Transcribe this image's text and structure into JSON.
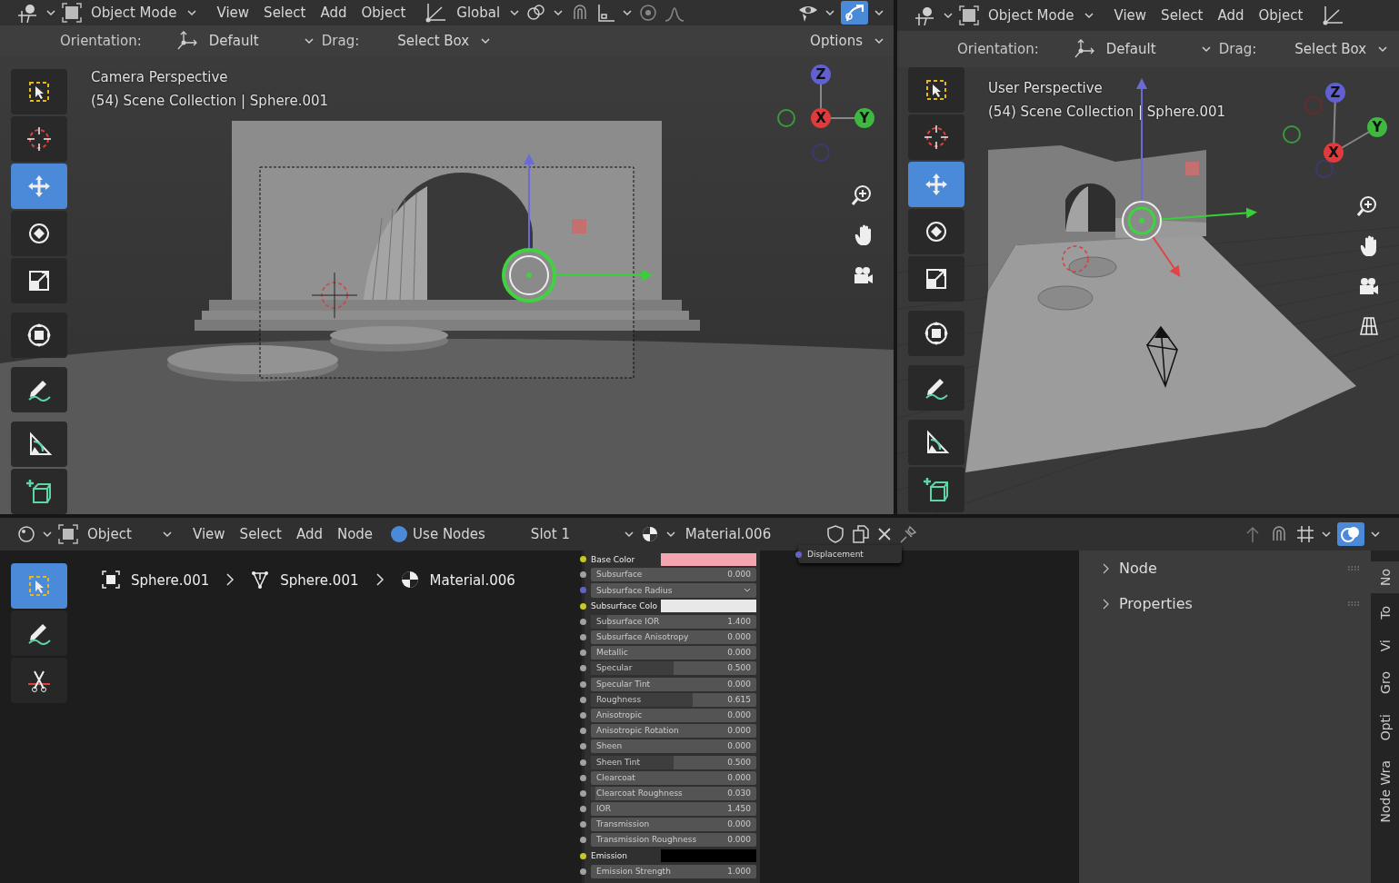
{
  "viewports": [
    {
      "kind": "camera",
      "header": {
        "mode": "Object Mode",
        "menus": [
          "View",
          "Select",
          "Add",
          "Object"
        ],
        "orientation": "Global",
        "gizmo_on": true
      },
      "tool_settings": {
        "orientation_label": "Orientation:",
        "orientation": "Default",
        "drag_label": "Drag:",
        "drag": "Select Box",
        "options": "Options"
      },
      "view_name": "Camera Perspective",
      "collection": "(54) Scene Collection | Sphere.001",
      "axes": [
        "Z",
        "X",
        "Y"
      ],
      "nav": [
        {
          "kind": "zoom"
        },
        {
          "kind": "pan"
        },
        {
          "kind": "camera"
        }
      ],
      "tools": [
        {
          "kind": "select",
          "selected": false
        },
        {
          "kind": "cursor",
          "selected": false
        },
        {
          "kind": "move",
          "selected": true
        },
        {
          "kind": "rotate",
          "selected": false
        },
        {
          "kind": "scale",
          "selected": false
        },
        {
          "kind": "transform",
          "selected": false
        },
        {
          "kind": "annotate",
          "selected": false
        },
        {
          "kind": "measure",
          "selected": false
        },
        {
          "kind": "add",
          "selected": false
        }
      ]
    },
    {
      "kind": "user",
      "header": {
        "mode": "Object Mode",
        "menus": [
          "View",
          "Select",
          "Add",
          "Object"
        ]
      },
      "tool_settings": {
        "orientation_label": "Orientation:",
        "orientation": "Default",
        "drag_label": "Drag:",
        "drag": "Select Box"
      },
      "view_name": "User Perspective",
      "collection": "(54) Scene Collection | Sphere.001",
      "axes": [
        "Z",
        "Y",
        "X"
      ],
      "nav": [
        {
          "kind": "zoom"
        },
        {
          "kind": "pan"
        },
        {
          "kind": "camera"
        },
        {
          "kind": "grid"
        }
      ],
      "tools": [
        {
          "kind": "select",
          "selected": false
        },
        {
          "kind": "cursor",
          "selected": false
        },
        {
          "kind": "move",
          "selected": true
        },
        {
          "kind": "rotate",
          "selected": false
        },
        {
          "kind": "scale",
          "selected": false
        },
        {
          "kind": "transform",
          "selected": false
        },
        {
          "kind": "annotate",
          "selected": false
        },
        {
          "kind": "measure",
          "selected": false
        },
        {
          "kind": "add",
          "selected": false
        }
      ]
    }
  ],
  "node_editor": {
    "header": {
      "mode": "Object",
      "menus": [
        "View",
        "Select",
        "Add",
        "Node"
      ],
      "use_nodes": {
        "label": "Use Nodes",
        "checked": true
      },
      "slot": "Slot 1",
      "material": "Material.006",
      "overlay_on": true
    },
    "tools": [
      {
        "kind": "select",
        "selected": true
      },
      {
        "kind": "annotate",
        "selected": false
      },
      {
        "kind": "cut",
        "selected": false
      }
    ],
    "breadcrumbs": [
      {
        "kind": "object",
        "label": "Sphere.001"
      },
      {
        "kind": "mesh",
        "label": "Sphere.001"
      },
      {
        "kind": "material",
        "label": "Material.006"
      }
    ],
    "output_socket": {
      "kind": "vector",
      "label": "Displacement"
    },
    "inputs": [
      {
        "kind": "color",
        "label": "Base Color",
        "color": "#f4a6b0"
      },
      {
        "kind": "value",
        "label": "Subsurface",
        "value": "0.000",
        "level": 0
      },
      {
        "kind": "vector",
        "label": "Subsurface Radius"
      },
      {
        "kind": "color",
        "label": "Subsurface Colo",
        "color": "#e8e8e8"
      },
      {
        "kind": "value",
        "label": "Subsurface IOR",
        "value": "1.400",
        "level": 0.1
      },
      {
        "kind": "value",
        "label": "Subsurface Anisotropy",
        "value": "0.000",
        "level": 0
      },
      {
        "kind": "value",
        "label": "Metallic",
        "value": "0.000",
        "level": 0
      },
      {
        "kind": "value",
        "label": "Specular",
        "value": "0.500",
        "level": 0.5
      },
      {
        "kind": "value",
        "label": "Specular Tint",
        "value": "0.000",
        "level": 0
      },
      {
        "kind": "value",
        "label": "Roughness",
        "value": "0.615",
        "level": 0.615
      },
      {
        "kind": "value",
        "label": "Anisotropic",
        "value": "0.000",
        "level": 0
      },
      {
        "kind": "value",
        "label": "Anisotropic Rotation",
        "value": "0.000",
        "level": 0
      },
      {
        "kind": "value",
        "label": "Sheen",
        "value": "0.000",
        "level": 0
      },
      {
        "kind": "value",
        "label": "Sheen Tint",
        "value": "0.500",
        "level": 0.5
      },
      {
        "kind": "value",
        "label": "Clearcoat",
        "value": "0.000",
        "level": 0
      },
      {
        "kind": "value",
        "label": "Clearcoat Roughness",
        "value": "0.030",
        "level": 0.03
      },
      {
        "kind": "value",
        "label": "IOR",
        "value": "1.450",
        "level": 0
      },
      {
        "kind": "value",
        "label": "Transmission",
        "value": "0.000",
        "level": 0
      },
      {
        "kind": "value",
        "label": "Transmission Roughness",
        "value": "0.000",
        "level": 0
      },
      {
        "kind": "color",
        "label": "Emission",
        "color": "#000000"
      },
      {
        "kind": "value",
        "label": "Emission Strength",
        "value": "1.000",
        "level": 0
      }
    ],
    "sidebar": {
      "panels": [
        {
          "label": "Node",
          "expanded": false
        },
        {
          "label": "Properties",
          "expanded": false
        }
      ],
      "tabs": [
        {
          "label": "No",
          "selected": true
        },
        {
          "label": "To",
          "selected": false
        },
        {
          "label": "Vi",
          "selected": false
        },
        {
          "label": "Gro",
          "selected": false
        },
        {
          "label": "Opti",
          "selected": false
        },
        {
          "label": "Node Wra",
          "selected": false
        }
      ]
    }
  }
}
